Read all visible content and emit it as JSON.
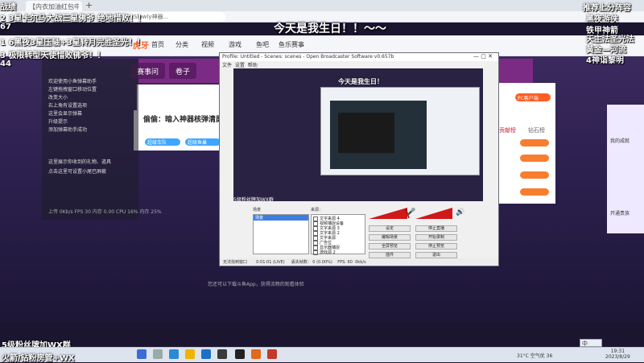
{
  "browser": {
    "tab_title": "【内衣加油红包中心_...",
    "new_tab": "+",
    "url": "Slowly神器...",
    "site_logo": "虎牙",
    "nav_items": [
      "首页",
      "分类",
      "视频",
      "游戏",
      "鱼吧",
      "鱼乐赛事"
    ]
  },
  "top_caption": "今天是我生日！！～～",
  "overlay_left": [
    "战绩",
    "2 3星卡尔马大战三星佛爷 绝地惜败！！",
    "67",
    "1 6黑夜3星压轴+3星转月完胜圣光！！",
    "3 极限转型天使惜败佛爷！！",
    "44"
  ],
  "overlay_right": [
    "推荐上分阵容",
    "黑夜游侠",
    "铁甲神箭",
    "天主法圣光法",
    "黄金—河流",
    "4神诣黎明"
  ],
  "left_hud": {
    "title": "欢迎使用小鱼弹幕助手",
    "lines": [
      "左键拖拽窗口移动位置",
      "改变大小",
      "右上角有设置选项",
      "这里会显示弹幕",
      "升级提示",
      "添加弹幕助手成功"
    ],
    "note1": "这里展示你收到的礼物、道具",
    "note2": "点击这里可设置小尾巴屏蔽",
    "stats": "上传 0Kb/s  FPS 30  内存 0.00  CPU 16%  内存 25%"
  },
  "room": {
    "tabs": [
      "赛事问",
      "卷子"
    ],
    "promo_title": "偷偷：暗入神器核弹清屏 场场达3！",
    "promo_badges": [
      "超级车队",
      "超级鱼巢"
    ],
    "chat_hint": "您还可以下载斗鱼App，获得流畅的观看体验",
    "right_labels": [
      "PC客户端",
      "贡献榜",
      "钻石榜",
      "开通贵族"
    ],
    "far_right": [
      "我的成就",
      "开通贵族"
    ]
  },
  "obs": {
    "title": "Profile: Untitled - Scenes: scenes - Open Broadcaster Software v0.657b",
    "menu": [
      "文件",
      "设置",
      "帮助",
      "全屏预览",
      "插件"
    ],
    "preview_caption": "今天是我生日！",
    "preview_footer": "5级粉丝牌加WX群",
    "scenes_label": "场景",
    "scenes": [
      "场景"
    ],
    "sources_label": "来源：",
    "sources": [
      "文字来源 4",
      "视频捕捉设备",
      "文字来源 3",
      "文字来源 2",
      "文字来源",
      "广告位",
      "显示器捕捉",
      "游戏源 2"
    ],
    "buttons_left": [
      "设定",
      "编辑场景",
      "全屏预览",
      "插件"
    ],
    "buttons_right": [
      "停止直播",
      "开始录制",
      "停止预览",
      "退出"
    ],
    "status": [
      "无法找到窗口",
      "0:01:01 (LIVE)",
      "丢失帧数： 0 (0.00%)",
      "FPS: 60",
      "0kb/s"
    ]
  },
  "overlay_bottom": [
    "5级粉丝牌加WX群",
    "火箭/钻粉房管+WX"
  ],
  "taskbar": {
    "tray": "31°C 空气优 36",
    "ime": "中",
    "time": "19:31",
    "date": "2023/8/29"
  },
  "colors": {
    "accent": "#ff5d23",
    "obs_select": "#3d7ee0",
    "room_purple": "#7c2b84"
  }
}
